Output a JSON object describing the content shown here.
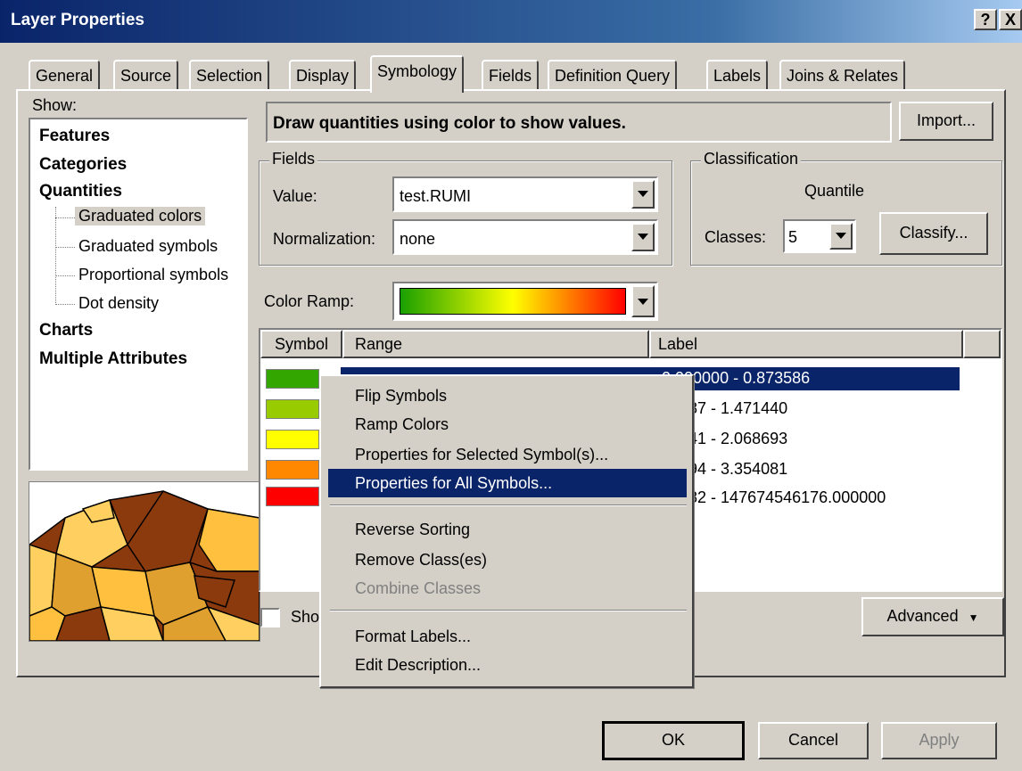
{
  "window": {
    "title": "Layer Properties",
    "help_btn": "?",
    "close_btn": "X"
  },
  "tabs": [
    "General",
    "Source",
    "Selection",
    "Display",
    "Symbology",
    "Fields",
    "Definition Query",
    "Labels",
    "Joins & Relates"
  ],
  "active_tab": "Symbology",
  "show": {
    "label": "Show:",
    "features": "Features",
    "categories": "Categories",
    "quantities": "Quantities",
    "graduated_colors": "Graduated colors",
    "graduated_symbols": "Graduated symbols",
    "proportional_symbols": "Proportional symbols",
    "dot_density": "Dot density",
    "charts": "Charts",
    "multiple_attributes": "Multiple Attributes"
  },
  "description": "Draw quantities using color to show values.",
  "import_button": "Import...",
  "fields": {
    "group": "Fields",
    "value_label": "Value:",
    "value": "test.RUMI",
    "normalization_label": "Normalization:",
    "normalization": "none"
  },
  "classification": {
    "group": "Classification",
    "method": "Quantile",
    "classes_label": "Classes:",
    "classes": "5",
    "classify_button": "Classify..."
  },
  "color_ramp_label": "Color Ramp:",
  "table": {
    "headers": {
      "symbol": "Symbol",
      "range": "Range",
      "label": "Label"
    },
    "rows": [
      {
        "color": "#33a600",
        "label": "0.000000 - 0.873586"
      },
      {
        "color": "#99cc00",
        "label": "73587 - 1.471440"
      },
      {
        "color": "#ffff00",
        "label": "71441 - 2.068693"
      },
      {
        "color": "#ff8800",
        "label": "68694 - 3.354081"
      },
      {
        "color": "#ff0000",
        "label": "54082 - 147674546176.000000"
      }
    ]
  },
  "show_checkbox_label": "Sho",
  "advanced_button": "Advanced",
  "context_menu": {
    "items": [
      "Flip Symbols",
      "Ramp Colors",
      "Properties for Selected Symbol(s)...",
      "Properties for All Symbols..."
    ],
    "items2": [
      "Reverse Sorting",
      "Remove Class(es)",
      "Combine Classes"
    ],
    "items3": [
      "Format Labels...",
      "Edit Description..."
    ]
  },
  "buttons": {
    "ok": "OK",
    "cancel": "Cancel",
    "apply": "Apply"
  }
}
